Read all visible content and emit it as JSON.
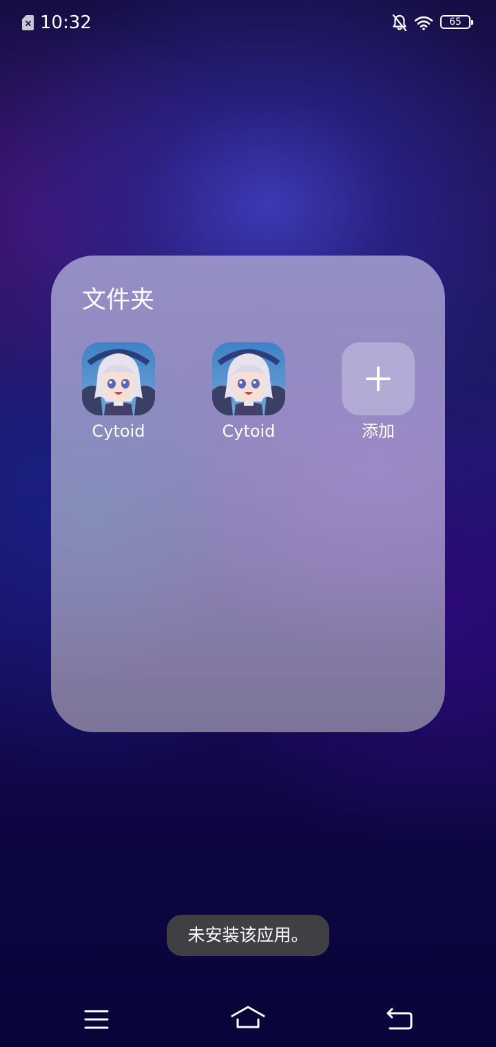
{
  "status_bar": {
    "time": "10:32",
    "battery_level": "65",
    "icons": [
      "sim-absent-icon",
      "bell-off-icon",
      "wifi-icon",
      "battery-icon"
    ]
  },
  "folder": {
    "title": "文件夹",
    "apps": [
      {
        "label": "Cytoid",
        "icon": "cytoid-app-icon"
      },
      {
        "label": "Cytoid",
        "icon": "cytoid-app-icon"
      }
    ],
    "add_label": "添加"
  },
  "toast": {
    "message": "未安装该应用。"
  },
  "nav_bar": {
    "icons": [
      "menu-icon",
      "home-icon",
      "back-icon"
    ]
  },
  "colors": {
    "folder_background": "#948fc5",
    "toast_background": "#3f3f44",
    "wallpaper_dark": "#08053a",
    "wallpaper_glow": "#3c3cb9"
  }
}
